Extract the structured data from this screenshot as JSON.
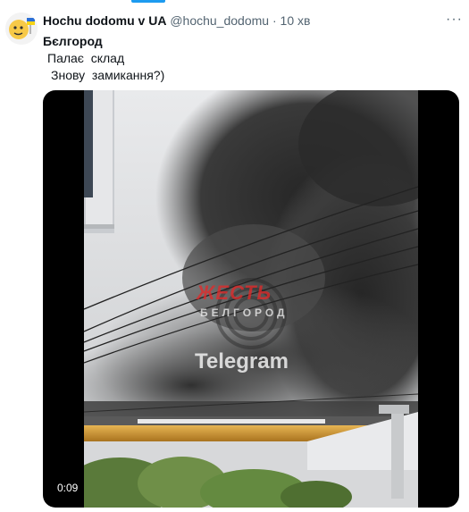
{
  "tweet": {
    "display_name": "Hochu dodomu v UA",
    "handle": "@hochu_dodomu",
    "separator": "·",
    "time": "10 хв",
    "more_icon": "more-horizontal-icon",
    "avatar_icon": "avatar-emoji-icon",
    "text_lines": [
      "Бєлгород",
      "Палає  склад",
      "Знову  замикання?)"
    ]
  },
  "media": {
    "type": "video",
    "watermark_brand": "ЖЕСТЬ",
    "watermark_city": "БЕЛГОРОД",
    "watermark_channel": "Telegram",
    "duration": "0:09"
  },
  "colors": {
    "accent": "#1d9bf0",
    "secondary_text": "#536471",
    "primary_text": "#0f1419",
    "smoke": "#3a3a3a",
    "pipe": "#d9a23c"
  }
}
